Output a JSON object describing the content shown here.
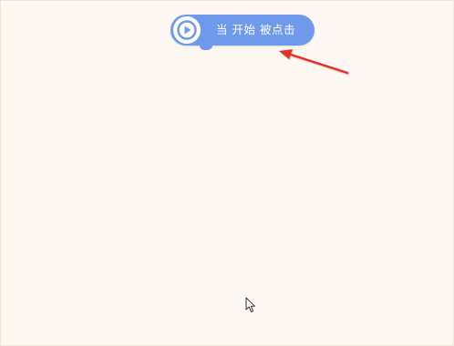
{
  "event_block": {
    "label": "当 开始 被点击",
    "color": "#6f9aec",
    "icon": "play-icon"
  },
  "annotation": {
    "icon": "red-arrow-icon",
    "color": "#e0302a"
  },
  "pointer": {
    "icon": "mouse-cursor-icon"
  }
}
